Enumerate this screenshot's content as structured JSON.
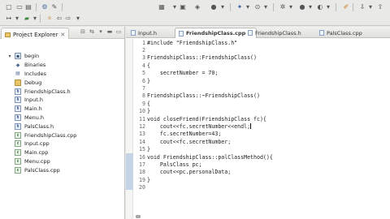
{
  "toolbar": {
    "row1_icons": [
      "new-file-icon",
      "save-icon",
      "print-icon",
      "separator",
      "build-gear-icon",
      "tools-icon",
      "separator",
      "run-icon",
      "debug-icon",
      "skip-icon",
      "separator",
      "external-tools-icon",
      "search-icon",
      "separator",
      "next-annotation-icon",
      "prev-annotation-icon",
      "separator",
      "back-icon",
      "forward-icon",
      "separator",
      "perspective-icon",
      "cpp-perspective-icon"
    ],
    "row2_icons": [
      "new-wizard-icon",
      "folder-icon",
      "build-icon",
      "nav-back-icon",
      "nav-forward-icon",
      "dropdown-icon"
    ]
  },
  "project_explorer": {
    "title": "Project Explorer",
    "tree": [
      {
        "label": "begin",
        "icon": "project-icon",
        "level": 0,
        "expanded": true
      },
      {
        "label": "Binaries",
        "icon": "binaries-icon",
        "level": 1
      },
      {
        "label": "Includes",
        "icon": "includes-icon",
        "level": 1
      },
      {
        "label": "Debug",
        "icon": "folder-icon",
        "level": 1
      },
      {
        "label": "FriendshipClass.h",
        "icon": "header-file-icon",
        "level": 1
      },
      {
        "label": "Input.h",
        "icon": "header-file-icon",
        "level": 1
      },
      {
        "label": "Main.h",
        "icon": "header-file-icon",
        "level": 1
      },
      {
        "label": "Menu.h",
        "icon": "header-file-icon",
        "level": 1
      },
      {
        "label": "PalsClass.h",
        "icon": "header-file-icon",
        "level": 1
      },
      {
        "label": "FriendshipClass.cpp",
        "icon": "source-file-icon",
        "level": 1
      },
      {
        "label": "Input.cpp",
        "icon": "source-file-icon",
        "level": 1
      },
      {
        "label": "Main.cpp",
        "icon": "source-file-icon",
        "level": 1
      },
      {
        "label": "Menu.cpp",
        "icon": "source-file-icon",
        "level": 1
      },
      {
        "label": "PalsClass.cpp",
        "icon": "source-file-icon",
        "level": 1
      }
    ]
  },
  "editor": {
    "tabs": [
      {
        "label": "Input.h",
        "active": false
      },
      {
        "label": "FriendshipClass.cpp",
        "active": true
      },
      {
        "label": "FriendshipClass.h",
        "active": false
      },
      {
        "label": "PalsClass.cpp",
        "active": false
      }
    ],
    "lines": [
      {
        "n": "1",
        "text": "#include \"FriendshipClass.h\""
      },
      {
        "n": "2",
        "text": ""
      },
      {
        "n": "3",
        "text": "FriendshipClass::FriendshipClass()"
      },
      {
        "n": "4",
        "text": "{"
      },
      {
        "n": "5",
        "text": "    secretNumber = 70;"
      },
      {
        "n": "6",
        "text": "}"
      },
      {
        "n": "7",
        "text": ""
      },
      {
        "n": "8",
        "text": "FriendshipClass::~FriendshipClass()"
      },
      {
        "n": "9",
        "text": "{"
      },
      {
        "n": "10",
        "text": "}"
      },
      {
        "n": "11",
        "text": "void closeFriend(FriendshipClass fc){"
      },
      {
        "n": "12",
        "text": "    cout<<fc.secretNumber<<endl;"
      },
      {
        "n": "13",
        "text": "    fc.secretNumber=43;"
      },
      {
        "n": "14",
        "text": "    cout<<fc.secretNumber;"
      },
      {
        "n": "15",
        "text": "}"
      },
      {
        "n": "16",
        "text": "void FriendshipClass::palClassMethod(){"
      },
      {
        "n": "17",
        "text": "    PalsClass pc;"
      },
      {
        "n": "18",
        "text": "    cout<<pc.personalData;"
      },
      {
        "n": "19",
        "text": "}"
      },
      {
        "n": "20",
        "text": ""
      }
    ],
    "caret_line": 12
  }
}
